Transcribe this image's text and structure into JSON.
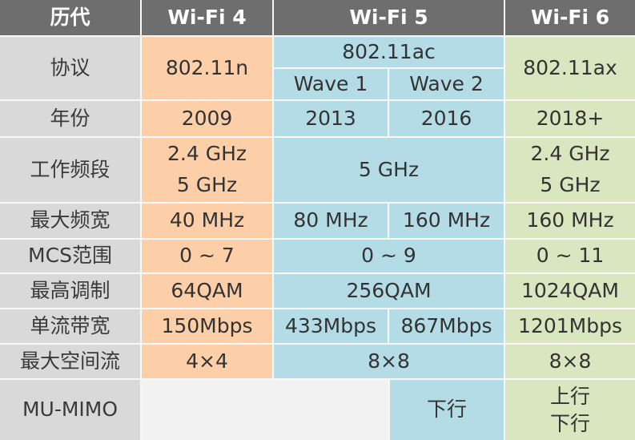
{
  "colors": {
    "header_bg": "#6e6e6e",
    "label_bg": "#d9d9d9",
    "wifi4_bg": "#fccfa8",
    "wifi5_bg": "#b4dce6",
    "wifi6_bg": "#d9e6bf",
    "empty_bg": "#f2f2f2"
  },
  "header": {
    "corner": "历代",
    "wifi4": "Wi-Fi 4",
    "wifi5": "Wi-Fi 5",
    "wifi6": "Wi-Fi 6"
  },
  "rows": {
    "protocol": {
      "label": "协议",
      "wifi4": "802.11n",
      "wifi5": "802.11ac",
      "wifi5_wave1": "Wave 1",
      "wifi5_wave2": "Wave 2",
      "wifi6": "802.11ax"
    },
    "year": {
      "label": "年份",
      "wifi4": "2009",
      "wifi5_wave1": "2013",
      "wifi5_wave2": "2016",
      "wifi6": "2018+"
    },
    "band": {
      "label": "工作频段",
      "wifi4": [
        "2.4 GHz",
        "5 GHz"
      ],
      "wifi5": "5 GHz",
      "wifi6": [
        "2.4 GHz",
        "5 GHz"
      ]
    },
    "max_bandwidth": {
      "label": "最大频宽",
      "wifi4": "40 MHz",
      "wifi5_wave1": "80 MHz",
      "wifi5_wave2": "160 MHz",
      "wifi6": "160 MHz"
    },
    "mcs": {
      "label": "MCS范围",
      "wifi4": "0 ~ 7",
      "wifi5": "0 ~ 9",
      "wifi6": "0 ~ 11"
    },
    "modulation": {
      "label": "最高调制",
      "wifi4": "64QAM",
      "wifi5": "256QAM",
      "wifi6": "1024QAM"
    },
    "single_stream": {
      "label": "单流带宽",
      "wifi4": "150Mbps",
      "wifi5_wave1": "433Mbps",
      "wifi5_wave2": "867Mbps",
      "wifi6": "1201Mbps"
    },
    "spatial_streams": {
      "label": "最大空间流",
      "wifi4": "4×4",
      "wifi5": "8×8",
      "wifi6": "8×8"
    },
    "mu_mimo": {
      "label": "MU-MIMO",
      "wifi5_wave2": "下行",
      "wifi6": [
        "上行",
        "下行"
      ]
    }
  }
}
